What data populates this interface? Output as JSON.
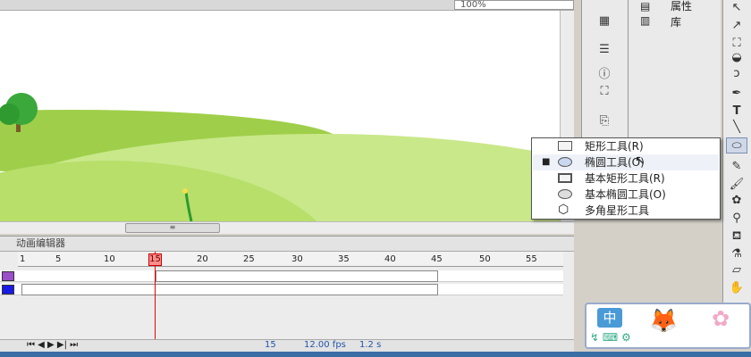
{
  "stage": {
    "zoom": "100%",
    "hscroll_grip": "≡"
  },
  "timeline": {
    "tab_label": "动画编辑器",
    "ruler": [
      "1",
      "5",
      "10",
      "15",
      "20",
      "25",
      "30",
      "35",
      "40",
      "45",
      "50",
      "55"
    ],
    "current_frame": "15",
    "fps": "12.00 fps",
    "time": "1.2 s",
    "layers": [
      {
        "color": "#9b4fc8"
      },
      {
        "color": "#1a1ae6"
      }
    ]
  },
  "panel": {
    "items": [
      "属性",
      "库"
    ]
  },
  "tool_menu": {
    "items": [
      {
        "label": "矩形工具(R)",
        "icon": "rectangle-icon",
        "selected": false
      },
      {
        "label": "椭圆工具(O)",
        "icon": "oval-icon",
        "selected": true
      },
      {
        "label": "基本矩形工具(R)",
        "icon": "primitive-rect-icon",
        "selected": false
      },
      {
        "label": "基本椭圆工具(O)",
        "icon": "primitive-oval-icon",
        "selected": false
      },
      {
        "label": "多角星形工具",
        "icon": "polystar-icon",
        "selected": false
      }
    ]
  },
  "tools": {
    "text_tool": "T"
  },
  "ime": {
    "label": "中"
  }
}
